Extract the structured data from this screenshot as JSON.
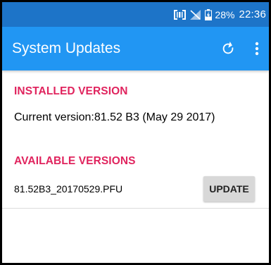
{
  "status_bar": {
    "battery_percent": "28%",
    "time": "22:36",
    "icons": [
      "barcode-scanner-icon",
      "no-signal-icon",
      "battery-charging-icon"
    ]
  },
  "app_bar": {
    "title": "System Updates",
    "actions": [
      "refresh-icon",
      "more-vert-icon"
    ]
  },
  "installed": {
    "header": "INSTALLED VERSION",
    "current_version": "Current version:81.52 B3 (May 29 2017)"
  },
  "available": {
    "header": "AVAILABLE VERSIONS",
    "items": [
      {
        "file_name": "81.52B3_20170529.PFU",
        "button_label": "UPDATE"
      }
    ]
  },
  "colors": {
    "status_bar": "#1d74c8",
    "app_bar": "#2196f3",
    "section_header": "#e0245e",
    "button": "#d8d8d8"
  }
}
